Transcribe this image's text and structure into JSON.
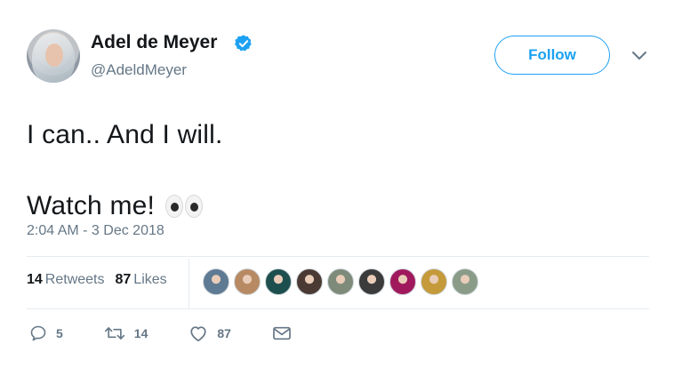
{
  "user": {
    "name": "Adel de Meyer",
    "handle": "@AdeldMeyer",
    "verified": true
  },
  "follow_button": {
    "label": "Follow"
  },
  "tweet": {
    "lines": [
      "I can.. And I will.",
      "Watch me!"
    ],
    "emoji": "eyes",
    "timestamp": "2:04 AM - 3 Dec 2018"
  },
  "stats": {
    "retweets_count": "14",
    "retweets_label": "Retweets",
    "likes_count": "87",
    "likes_label": "Likes"
  },
  "liker_avatars": [
    {
      "color": "#5f7a93"
    },
    {
      "color": "#b88a63"
    },
    {
      "color": "#1e4f4f"
    },
    {
      "color": "#4a3a33"
    },
    {
      "color": "#7f8b7a"
    },
    {
      "color": "#3b3b3b"
    },
    {
      "color": "#a0195d"
    },
    {
      "color": "#c59a3a"
    },
    {
      "color": "#8a9c88"
    }
  ],
  "actions": {
    "reply_count": "5",
    "retweet_count": "14",
    "like_count": "87"
  },
  "colors": {
    "accent": "#1da1f2",
    "secondary_text": "#657786",
    "primary_text": "#14171a"
  }
}
